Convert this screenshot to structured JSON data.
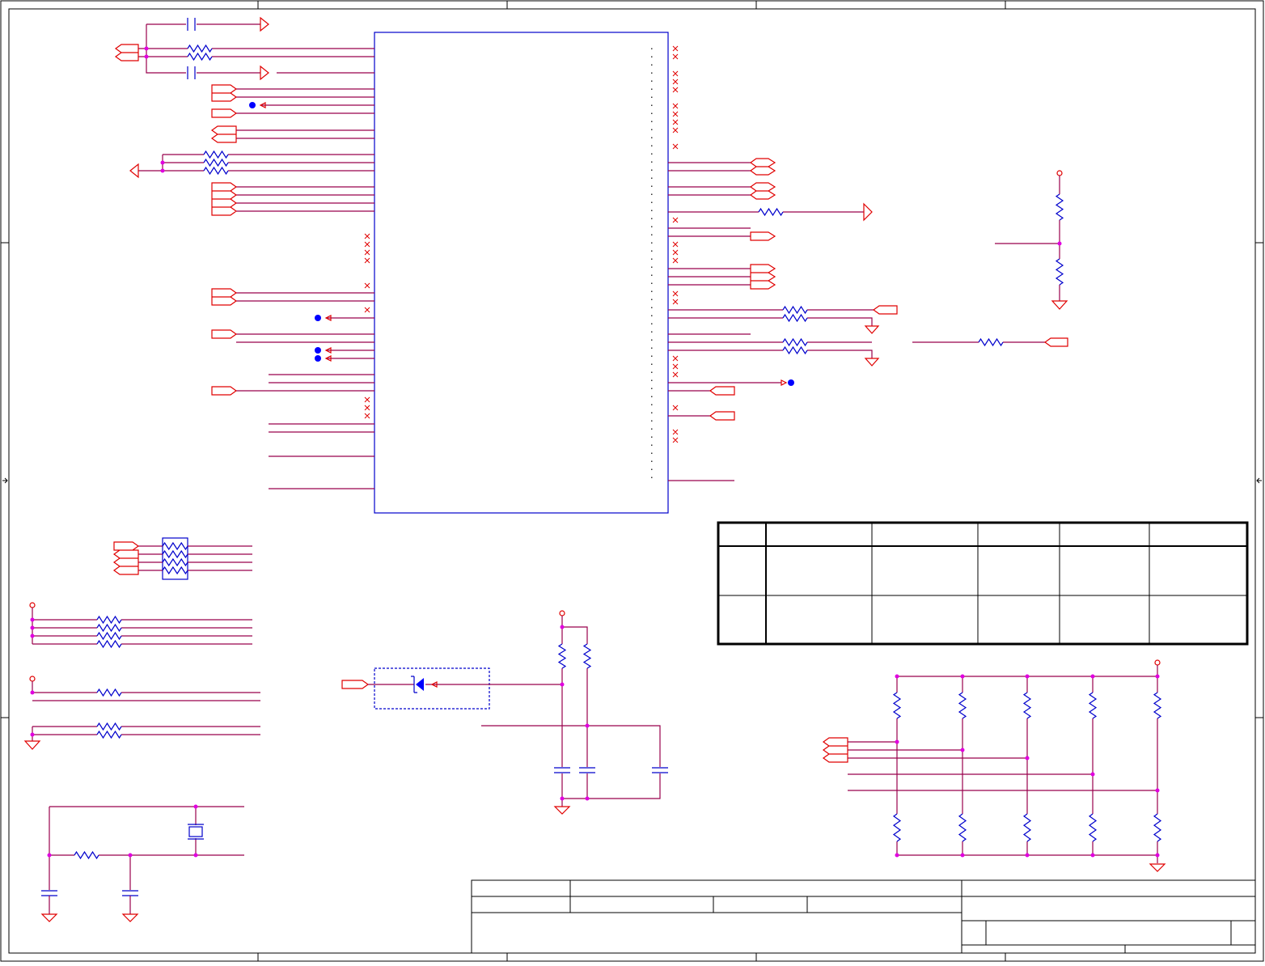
{
  "diagram": {
    "kind": "electrical schematic sheet",
    "colors": {
      "wire": "#99004c",
      "symbol": "#e00000",
      "component": "#0000cc",
      "junction": "#e000e0",
      "frame": "#000000"
    }
  },
  "option_table": {
    "columns": 6,
    "rows": 3,
    "cells": [
      [
        "",
        "",
        "",
        "",
        "",
        ""
      ],
      [
        "",
        "",
        "",
        "",
        "",
        ""
      ],
      [
        "",
        "",
        "",
        "",
        "",
        ""
      ]
    ]
  },
  "title_block": {
    "title": "",
    "size": "",
    "document_number": "",
    "revision": "",
    "date": "",
    "sheet": ""
  }
}
